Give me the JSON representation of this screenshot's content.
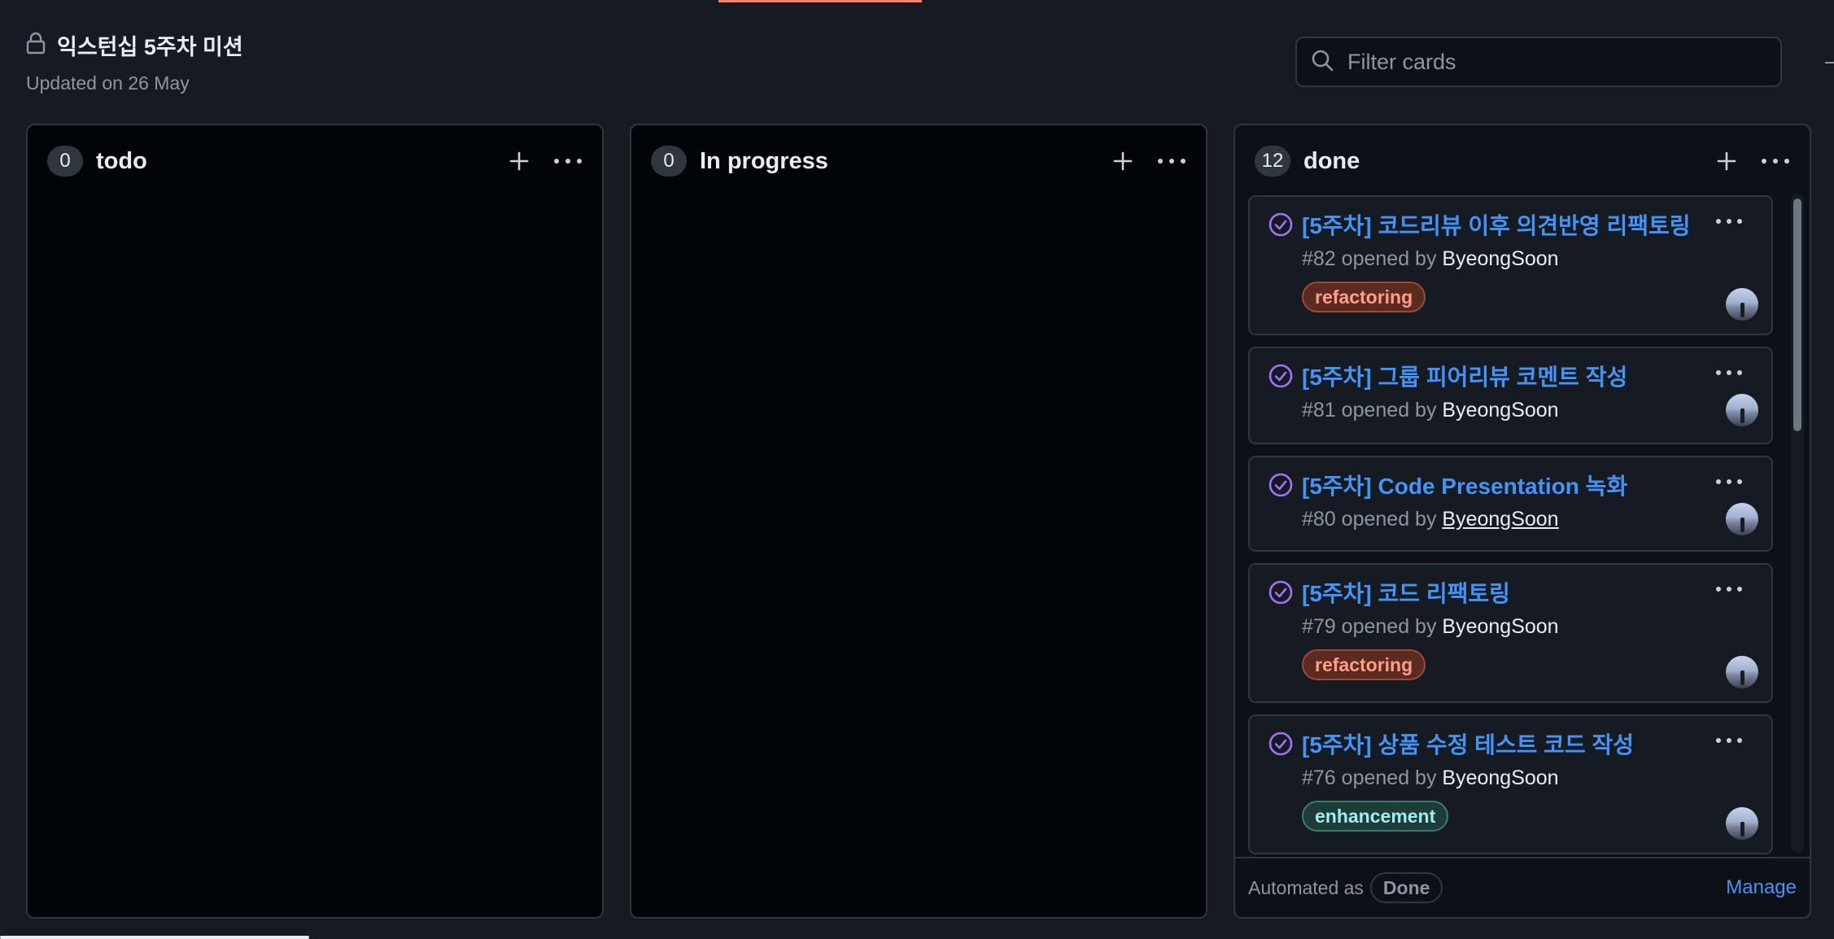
{
  "project": {
    "title": "익스턴십 5주차 미션",
    "updated": "Updated on 26 May"
  },
  "filter": {
    "placeholder": "Filter cards"
  },
  "colors": {
    "accent": "#f78166",
    "link": "#4493f8",
    "closed_icon": "#a371f7"
  },
  "columns": [
    {
      "name": "todo",
      "count": "0",
      "cards": []
    },
    {
      "name": "In progress",
      "count": "0",
      "cards": []
    },
    {
      "name": "done",
      "count": "12",
      "cards": [
        {
          "title": "[5주차] 코드리뷰 이후 의견반영 리팩토링",
          "number": "#82",
          "opened_by": "opened by",
          "author": "ByeongSoon",
          "label": "refactoring"
        },
        {
          "title": "[5주차] 그룹 피어리뷰 코멘트 작성",
          "number": "#81",
          "opened_by": "opened by",
          "author": "ByeongSoon",
          "label": ""
        },
        {
          "title": "[5주차] Code Presentation 녹화",
          "number": "#80",
          "opened_by": "opened by",
          "author": "ByeongSoon",
          "label": ""
        },
        {
          "title": "[5주차] 코드 리팩토링",
          "number": "#79",
          "opened_by": "opened by",
          "author": "ByeongSoon",
          "label": "refactoring"
        },
        {
          "title": "[5주차] 상품 수정 테스트 코드 작성",
          "number": "#76",
          "opened_by": "opened by",
          "author": "ByeongSoon",
          "label": "enhancement"
        }
      ],
      "footer": {
        "automated_text": "Automated as",
        "automation": "Done",
        "manage": "Manage"
      }
    }
  ]
}
